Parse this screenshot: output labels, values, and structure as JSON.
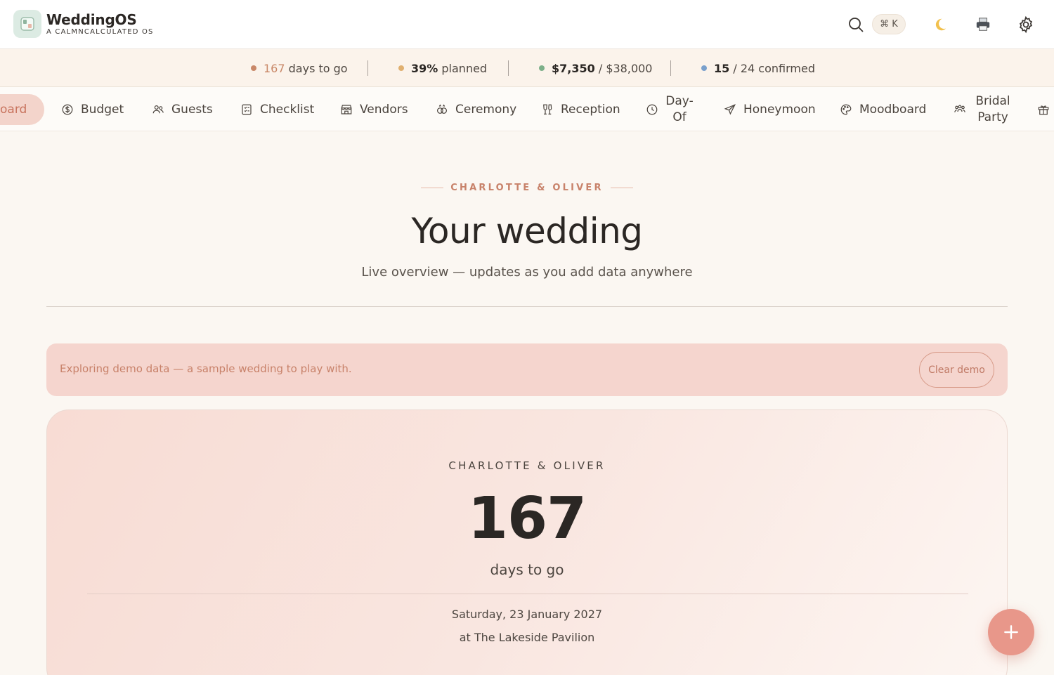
{
  "app": {
    "name": "WeddingOS",
    "tagline": "A CALMNCALCULATED OS"
  },
  "header": {
    "shortcut": "⌘ K",
    "theme_icon": "moon-icon",
    "print_icon": "printer-icon",
    "settings_icon": "gear-icon"
  },
  "stats": {
    "days": {
      "value": "167",
      "label": "days to go",
      "color": "#c98868"
    },
    "planned": {
      "value": "39%",
      "label": "planned",
      "color": "#e0b070"
    },
    "budget": {
      "spent": "$7,350",
      "total": "/ $38,000",
      "color": "#7db08a"
    },
    "guests": {
      "confirmed": "15",
      "total": "/ 24 confirmed",
      "color": "#7aa0cc"
    }
  },
  "nav": {
    "active": "oard",
    "items": [
      {
        "label": "Budget",
        "icon": "dollar-icon"
      },
      {
        "label": "Guests",
        "icon": "users-icon"
      },
      {
        "label": "Checklist",
        "icon": "checklist-icon"
      },
      {
        "label": "Vendors",
        "icon": "store-icon"
      },
      {
        "label": "Ceremony",
        "icon": "rings-icon"
      },
      {
        "label": "Reception",
        "icon": "glass-icon"
      },
      {
        "label": "Day-Of",
        "icon": "clock-icon"
      },
      {
        "label": "Honeymoon",
        "icon": "plane-icon"
      },
      {
        "label": "Moodboard",
        "icon": "palette-icon"
      },
      {
        "label": "Bridal Party",
        "icon": "party-icon"
      }
    ]
  },
  "hero": {
    "kicker": "CHARLOTTE & OLIVER",
    "title": "Your wedding",
    "subtitle": "Live overview — updates as you add data anywhere"
  },
  "demo": {
    "message": "Exploring demo data — a sample wedding to play with.",
    "button": "Clear demo"
  },
  "countdown": {
    "couple": "CHARLOTTE & OLIVER",
    "days": "167",
    "label": "days to go",
    "date": "Saturday, 23 January 2027",
    "venue": "at The Lakeside Pavilion"
  },
  "colors": {
    "accent": "#e8978a",
    "background": "#fbf7f2",
    "banner": "#f5d5ce"
  }
}
